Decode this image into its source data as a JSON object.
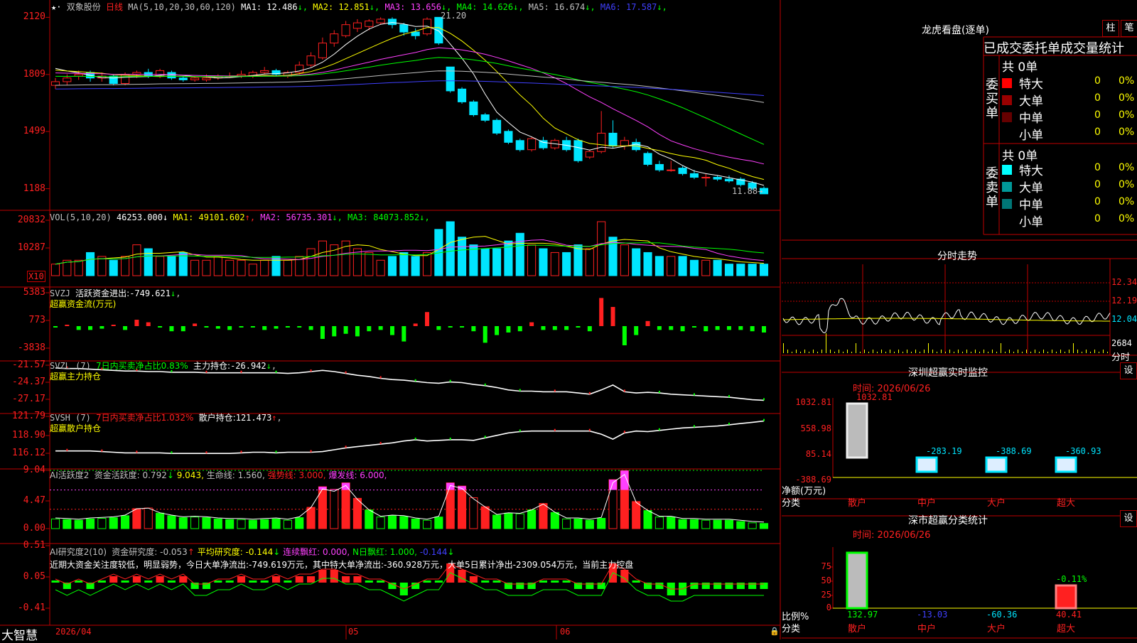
{
  "app_name": "大智慧",
  "stock": {
    "name": "双象股份",
    "period": "日线"
  },
  "colors": {
    "up": "#ff2020",
    "down": "#00e5ff",
    "grid": "#c00000",
    "yellow": "#ffff00",
    "magenta": "#ff40ff",
    "green": "#00ff00",
    "white": "#ffffff",
    "blue": "#4040ff",
    "gray": "#c0c0c0"
  },
  "main_panel": {
    "ma_label": "MA(5,10,20,30,60,120)",
    "ma": [
      {
        "label": "MA1:",
        "value": "12.486",
        "arrow": "↓",
        "color": "#ffffff"
      },
      {
        "label": "MA2:",
        "value": "12.851",
        "arrow": "↓",
        "color": "#ffff00"
      },
      {
        "label": "MA3:",
        "value": "13.656",
        "arrow": "↓",
        "color": "#ff40ff"
      },
      {
        "label": "MA4:",
        "value": "14.626",
        "arrow": "↓",
        "color": "#00ff00"
      },
      {
        "label": "MA5:",
        "value": "16.674",
        "arrow": "↓",
        "color": "#c0c0c0"
      },
      {
        "label": "MA6:",
        "value": "17.587",
        "arrow": "↓",
        "color": "#4040ff"
      }
    ],
    "y_ticks": [
      "2120",
      "1809",
      "1499",
      "1188"
    ],
    "high_label": "21.20",
    "low_label": "11.88"
  },
  "candles": [
    {
      "o": 17.5,
      "c": 17.7,
      "h": 17.9,
      "l": 17.3
    },
    {
      "o": 17.7,
      "c": 17.9,
      "h": 18.1,
      "l": 17.5
    },
    {
      "o": 18.0,
      "c": 18.1,
      "h": 18.3,
      "l": 17.8
    },
    {
      "o": 18.2,
      "c": 17.9,
      "h": 18.3,
      "l": 17.7
    },
    {
      "o": 17.9,
      "c": 18.0,
      "h": 18.2,
      "l": 17.7
    },
    {
      "o": 18.0,
      "c": 17.6,
      "h": 18.1,
      "l": 17.5
    },
    {
      "o": 17.6,
      "c": 18.1,
      "h": 18.2,
      "l": 17.5
    },
    {
      "o": 18.1,
      "c": 18.2,
      "h": 18.3,
      "l": 17.9
    },
    {
      "o": 18.2,
      "c": 18.0,
      "h": 18.4,
      "l": 17.9
    },
    {
      "o": 18.0,
      "c": 18.3,
      "h": 18.4,
      "l": 17.9
    },
    {
      "o": 18.2,
      "c": 17.9,
      "h": 18.3,
      "l": 17.8
    },
    {
      "o": 17.9,
      "c": 17.8,
      "h": 18.0,
      "l": 17.7
    },
    {
      "o": 17.8,
      "c": 17.9,
      "h": 18.0,
      "l": 17.7
    },
    {
      "o": 17.8,
      "c": 17.9,
      "h": 18.1,
      "l": 17.7
    },
    {
      "o": 17.9,
      "c": 18.0,
      "h": 18.1,
      "l": 17.8
    },
    {
      "o": 18.0,
      "c": 18.0,
      "h": 18.2,
      "l": 17.9
    },
    {
      "o": 18.0,
      "c": 18.1,
      "h": 18.3,
      "l": 17.9
    },
    {
      "o": 18.0,
      "c": 18.2,
      "h": 18.3,
      "l": 17.9
    },
    {
      "o": 18.2,
      "c": 18.3,
      "h": 18.5,
      "l": 18.1
    },
    {
      "o": 18.3,
      "c": 18.1,
      "h": 18.4,
      "l": 18.0
    },
    {
      "o": 18.0,
      "c": 18.2,
      "h": 18.3,
      "l": 17.9
    },
    {
      "o": 18.2,
      "c": 18.6,
      "h": 18.8,
      "l": 18.1
    },
    {
      "o": 18.6,
      "c": 19.1,
      "h": 19.3,
      "l": 18.5
    },
    {
      "o": 19.0,
      "c": 19.8,
      "h": 20.1,
      "l": 18.9
    },
    {
      "o": 19.8,
      "c": 20.3,
      "h": 20.5,
      "l": 19.6
    },
    {
      "o": 20.2,
      "c": 20.8,
      "h": 21.0,
      "l": 20.1
    },
    {
      "o": 20.6,
      "c": 20.9,
      "h": 21.1,
      "l": 20.4
    },
    {
      "o": 20.7,
      "c": 21.0,
      "h": 21.1,
      "l": 20.5
    },
    {
      "o": 20.9,
      "c": 21.1,
      "h": 21.2,
      "l": 20.8
    },
    {
      "o": 21.1,
      "c": 20.8,
      "h": 21.2,
      "l": 20.6
    },
    {
      "o": 20.8,
      "c": 20.4,
      "h": 20.9,
      "l": 20.2
    },
    {
      "o": 20.4,
      "c": 20.2,
      "h": 20.6,
      "l": 20.0
    },
    {
      "o": 20.3,
      "c": 21.1,
      "h": 21.2,
      "l": 20.2
    },
    {
      "o": 21.2,
      "c": 19.8,
      "h": 21.2,
      "l": 19.7
    },
    {
      "o": 18.5,
      "c": 17.2,
      "h": 18.5,
      "l": 17.1
    },
    {
      "o": 17.3,
      "c": 16.6,
      "h": 17.4,
      "l": 16.5
    },
    {
      "o": 16.6,
      "c": 15.9,
      "h": 16.7,
      "l": 15.8
    },
    {
      "o": 15.9,
      "c": 15.6,
      "h": 16.0,
      "l": 15.5
    },
    {
      "o": 15.6,
      "c": 14.9,
      "h": 15.7,
      "l": 14.8
    },
    {
      "o": 15.0,
      "c": 14.4,
      "h": 15.1,
      "l": 14.3
    },
    {
      "o": 14.5,
      "c": 14.0,
      "h": 14.6,
      "l": 13.9
    },
    {
      "o": 14.0,
      "c": 14.6,
      "h": 14.7,
      "l": 13.9
    },
    {
      "o": 14.5,
      "c": 14.1,
      "h": 14.7,
      "l": 14.0
    },
    {
      "o": 14.1,
      "c": 14.5,
      "h": 14.6,
      "l": 14.0
    },
    {
      "o": 14.5,
      "c": 14.0,
      "h": 14.7,
      "l": 13.9
    },
    {
      "o": 14.5,
      "c": 13.4,
      "h": 14.6,
      "l": 13.3
    },
    {
      "o": 13.6,
      "c": 13.9,
      "h": 14.0,
      "l": 13.5
    },
    {
      "o": 13.9,
      "c": 14.9,
      "h": 16.1,
      "l": 13.8
    },
    {
      "o": 14.9,
      "c": 14.2,
      "h": 15.6,
      "l": 14.1
    },
    {
      "o": 14.2,
      "c": 14.5,
      "h": 14.7,
      "l": 14.0
    },
    {
      "o": 14.4,
      "c": 14.0,
      "h": 14.6,
      "l": 13.9
    },
    {
      "o": 13.8,
      "c": 13.2,
      "h": 13.9,
      "l": 13.1
    },
    {
      "o": 13.2,
      "c": 12.9,
      "h": 13.4,
      "l": 12.8
    },
    {
      "o": 12.9,
      "c": 12.9,
      "h": 13.4,
      "l": 12.8
    },
    {
      "o": 13.0,
      "c": 12.7,
      "h": 13.1,
      "l": 12.6
    },
    {
      "o": 12.7,
      "c": 12.5,
      "h": 12.9,
      "l": 12.4
    },
    {
      "o": 12.5,
      "c": 12.5,
      "h": 12.7,
      "l": 12.0
    },
    {
      "o": 12.5,
      "c": 12.4,
      "h": 12.6,
      "l": 12.3
    },
    {
      "o": 12.4,
      "c": 12.3,
      "h": 12.6,
      "l": 12.2
    },
    {
      "o": 12.4,
      "c": 12.1,
      "h": 12.5,
      "l": 12.0
    },
    {
      "o": 12.2,
      "c": 11.9,
      "h": 12.3,
      "l": 11.8
    },
    {
      "o": 11.9,
      "c": 11.6,
      "h": 12.0,
      "l": 11.6
    }
  ],
  "vol_panel": {
    "label": "VOL(5,10,20)",
    "value": "46253.000",
    "value_arrow": "↓",
    "ma": [
      {
        "label": "MA1:",
        "value": "49101.602",
        "arrow": "↑",
        "color": "#ffff00"
      },
      {
        "label": "MA2:",
        "value": "56735.301",
        "arrow": "↓",
        "color": "#ff40ff"
      },
      {
        "label": "MA3:",
        "value": "84073.852",
        "arrow": "↓",
        "color": "#00ff00"
      }
    ],
    "y_ticks": [
      "20832",
      "10287"
    ],
    "unit": "X10",
    "values": [
      3,
      4,
      4,
      6,
      5,
      4,
      5,
      8,
      7,
      5,
      5,
      6,
      4,
      4,
      5,
      4,
      4,
      3,
      4,
      5,
      4,
      5,
      7,
      9,
      8,
      9,
      7,
      6,
      4,
      5,
      6,
      5,
      6,
      12,
      14,
      10,
      8,
      7,
      7,
      9,
      11,
      8,
      7,
      6,
      6,
      8,
      7,
      14,
      10,
      8,
      7,
      6,
      5,
      5,
      5,
      4,
      4,
      4,
      3,
      3,
      3,
      3
    ]
  },
  "svzj_panel": {
    "label": "SVZJ",
    "title": "活跃资金进出:",
    "value": "-749.621",
    "arrow": "↓",
    "subtitle": "超赢资金流(万元)",
    "y_ticks": [
      "5383",
      "773",
      "-3838"
    ],
    "values": [
      -0.1,
      0.1,
      -0.3,
      -0.3,
      -0.2,
      0.1,
      -0.3,
      0.5,
      0.3,
      -0.1,
      -0.4,
      -0.4,
      0.2,
      -0.1,
      -0.2,
      -0.3,
      -0.1,
      -0.1,
      -0.3,
      -0.2,
      -0.1,
      -0.1,
      -0.3,
      -1.0,
      -0.8,
      -0.6,
      -0.8,
      -0.4,
      -0.3,
      -0.7,
      -1.2,
      0.2,
      1.1,
      -0.3,
      -0.1,
      -0.1,
      -0.4,
      -1.3,
      -0.7,
      -0.5,
      -0.4,
      0.3,
      -0.3,
      -0.3,
      -0.3,
      -0.1,
      -0.4,
      2.2,
      1.5,
      -1.5,
      -0.7,
      0.4,
      -0.3,
      -0.3,
      -0.4,
      -0.1,
      -0.4,
      -0.3,
      -0.3,
      -0.3,
      -0.4,
      -0.5
    ]
  },
  "svzl_panel": {
    "label": "SVZL (7)",
    "title": "7日内买卖净占比0.83%",
    "sub_title": "主力持仓:",
    "value": "-26.942",
    "arrow": "↓",
    "subtitle": "超赢主力持仓",
    "y_ticks": [
      "-21.57",
      "-24.37",
      "-27.17"
    ],
    "values": [
      -21.6,
      -21.7,
      -21.7,
      -21.8,
      -21.9,
      -22.0,
      -22.1,
      -22.1,
      -22.2,
      -22.2,
      -22.3,
      -22.3,
      -22.3,
      -22.4,
      -22.4,
      -22.4,
      -22.4,
      -22.4,
      -22.4,
      -22.4,
      -22.5,
      -22.4,
      -22.2,
      -22.0,
      -22.2,
      -22.5,
      -22.8,
      -23.0,
      -23.3,
      -23.5,
      -23.6,
      -23.8,
      -24.0,
      -24.1,
      -23.9,
      -24.0,
      -24.3,
      -24.5,
      -24.8,
      -25.2,
      -25.4,
      -25.4,
      -25.5,
      -25.5,
      -25.5,
      -25.7,
      -25.9,
      -25.2,
      -24.4,
      -25.5,
      -25.7,
      -25.6,
      -25.7,
      -25.9,
      -26.0,
      -26.1,
      -26.2,
      -26.3,
      -26.4,
      -26.6,
      -26.8,
      -26.9
    ]
  },
  "svsh_panel": {
    "label": "SVSH (7)",
    "title": "7日内买卖净占比1.032%",
    "sub_title": "散户持仓:",
    "value": "121.473",
    "arrow": "↑",
    "subtitle": "超赢散户持仓",
    "y_ticks": [
      "121.79",
      "118.90",
      "116.12"
    ],
    "values": [
      116.7,
      116.7,
      116.7,
      116.7,
      116.6,
      116.5,
      116.4,
      116.4,
      116.4,
      116.4,
      116.3,
      116.3,
      116.3,
      116.3,
      116.3,
      116.3,
      116.4,
      116.5,
      116.5,
      116.4,
      116.5,
      116.5,
      116.5,
      116.6,
      116.9,
      117.2,
      117.4,
      117.6,
      117.8,
      118.0,
      118.3,
      118.5,
      118.3,
      118.4,
      118.5,
      118.5,
      118.4,
      118.8,
      119.2,
      119.6,
      119.8,
      119.9,
      119.9,
      119.9,
      119.9,
      119.9,
      119.9,
      119.4,
      118.6,
      119.6,
      119.9,
      119.8,
      120.0,
      120.2,
      120.4,
      120.5,
      120.6,
      120.7,
      120.9,
      121.1,
      121.3,
      121.5
    ]
  },
  "ai_panel": {
    "label": "AI活跃度2",
    "items": [
      {
        "text": "资金活跃度: 0.792",
        "arrow": "↓",
        "color": "#c0c0c0"
      },
      {
        "text": "9.043",
        "arrow": ",",
        "color": "#ffff00"
      },
      {
        "text": "生命线: 1.560",
        "arrow": ",",
        "color": "#c0c0c0"
      },
      {
        "text": "强势线: 3.000",
        "arrow": ",",
        "color": "#ff2020"
      },
      {
        "text": "爆发线: 6.000",
        "arrow": ",",
        "color": "#ff40ff"
      }
    ],
    "y_ticks": [
      "9.04",
      "4.47",
      "0.00"
    ],
    "values": [
      1.5,
      1.4,
      1.3,
      1.5,
      1.6,
      1.7,
      2.0,
      3.1,
      3.2,
      2.4,
      2.0,
      1.7,
      1.8,
      1.7,
      1.5,
      1.4,
      1.4,
      1.3,
      1.4,
      1.5,
      1.3,
      1.7,
      3.3,
      6.5,
      6.1,
      7.1,
      4.7,
      2.9,
      1.8,
      2.0,
      1.9,
      1.5,
      1.3,
      1.8,
      7.1,
      6.6,
      4.8,
      3.4,
      2.1,
      2.4,
      2.3,
      2.9,
      3.9,
      2.5,
      1.5,
      1.5,
      1.3,
      1.6,
      7.6,
      9.0,
      4.2,
      2.8,
      1.8,
      1.8,
      1.4,
      1.4,
      1.3,
      1.3,
      1.3,
      1.1,
      0.9,
      0.8
    ]
  },
  "ai_research_panel": {
    "label": "AI研究度2(10)",
    "items": [
      {
        "text": "资金研究度: -0.053",
        "arrow": "↑",
        "color": "#c0c0c0"
      },
      {
        "text": "平均研究度: -0.144",
        "arrow": "↓",
        "color": "#ffff00"
      },
      {
        "text": "连续飘红: 0.000",
        "arrow": ",",
        "color": "#ff40ff"
      },
      {
        "text": "N日飘红: 1.000",
        "arrow": ",",
        "color": "#00ff00"
      },
      {
        "text": "-0.144",
        "arrow": "↓",
        "color": "#4040ff"
      }
    ],
    "comment": "近期大资金关注度较低，明显弱势，今日大单净流出:-749.619万元，其中特大单净流出:-360.928万元，大单5日累计净出-2309.054万元，当前主力控盘",
    "y_ticks": [
      "0.51",
      "0.05",
      "-0.41"
    ],
    "values": [
      0.0,
      -0.1,
      0.0,
      -0.1,
      0.0,
      0.1,
      0.0,
      0.1,
      0.0,
      0.1,
      0.0,
      0.1,
      -0.1,
      -0.1,
      0.0,
      0.0,
      0.1,
      0.0,
      0.0,
      0.1,
      0.0,
      0.1,
      0.1,
      0.2,
      0.2,
      0.1,
      0.1,
      0.0,
      0.0,
      -0.1,
      -0.2,
      -0.1,
      0.0,
      0.0,
      0.3,
      0.2,
      0.1,
      0.0,
      0.0,
      -0.1,
      -0.1,
      -0.1,
      0.0,
      0.0,
      0.0,
      -0.1,
      -0.1,
      -0.1,
      0.3,
      0.2,
      0.0,
      -0.1,
      -0.1,
      -0.2,
      -0.2,
      -0.1,
      -0.1,
      -0.1,
      -0.1,
      -0.1,
      -0.1,
      -0.1
    ]
  },
  "dates": {
    "start": "2026/04",
    "m1": "05",
    "m2": "06"
  },
  "right_panel": {
    "lh_title": "龙虎看盘(逐单)",
    "tab_bar": "柱",
    "tab_order": "笔",
    "stat_header": "已成交委托单成交量统计",
    "buy_label": "委买单",
    "sell_label": "委卖单",
    "buy_total": "共 0单",
    "sell_total": "共 0单",
    "buy_rows": [
      {
        "name": "特大",
        "count": "0",
        "pct": "0%",
        "color": "#ff0000"
      },
      {
        "name": "大单",
        "count": "0",
        "pct": "0%",
        "color": "#990000"
      },
      {
        "name": "中单",
        "count": "0",
        "pct": "0%",
        "color": "#660000"
      },
      {
        "name": "小单",
        "count": "0",
        "pct": "0%",
        "color": ""
      }
    ],
    "sell_rows": [
      {
        "name": "特大",
        "count": "0",
        "pct": "0%",
        "color": "#00ffff"
      },
      {
        "name": "大单",
        "count": "0",
        "pct": "0%",
        "color": "#009999"
      },
      {
        "name": "中单",
        "count": "0",
        "pct": "0%",
        "color": "#007777"
      },
      {
        "name": "小单",
        "count": "0",
        "pct": "0%",
        "color": ""
      }
    ],
    "intraday_title": "分时走势",
    "intraday_ticks": [
      "12.34",
      "12.19",
      "12.04",
      "2684"
    ],
    "intraday_unit": "分时",
    "monitor_title": "深圳超赢实时监控",
    "monitor_settings": "设",
    "monitor_time": "时间: 2026/06/26",
    "monitor_ticks": [
      "1032.81",
      "558.98",
      "85.14",
      "-388.69"
    ],
    "monitor_ylabel": "净额(万元)",
    "monitor_xlabel": "分类",
    "monitor_bars": [
      {
        "name": "散户",
        "value": "1032.81"
      },
      {
        "name": "中户",
        "value": "-283.19"
      },
      {
        "name": "大户",
        "value": "-388.69"
      },
      {
        "name": "超大",
        "value": "-360.93"
      }
    ],
    "class_title": "深市超赢分类统计",
    "class_settings": "设",
    "class_time": "时间: 2026/06/26",
    "class_ticks": [
      "75",
      "50",
      "25",
      "0"
    ],
    "class_ylabel": "比例%",
    "class_xlabel": "分类",
    "class_bars": [
      {
        "name": "散户",
        "value": "132.97",
        "top": ""
      },
      {
        "name": "中户",
        "value": "-13.03",
        "top": ""
      },
      {
        "name": "大户",
        "value": "-60.36",
        "top": ""
      },
      {
        "name": "超大",
        "value": "40.41",
        "top": "-0.11%"
      }
    ]
  }
}
